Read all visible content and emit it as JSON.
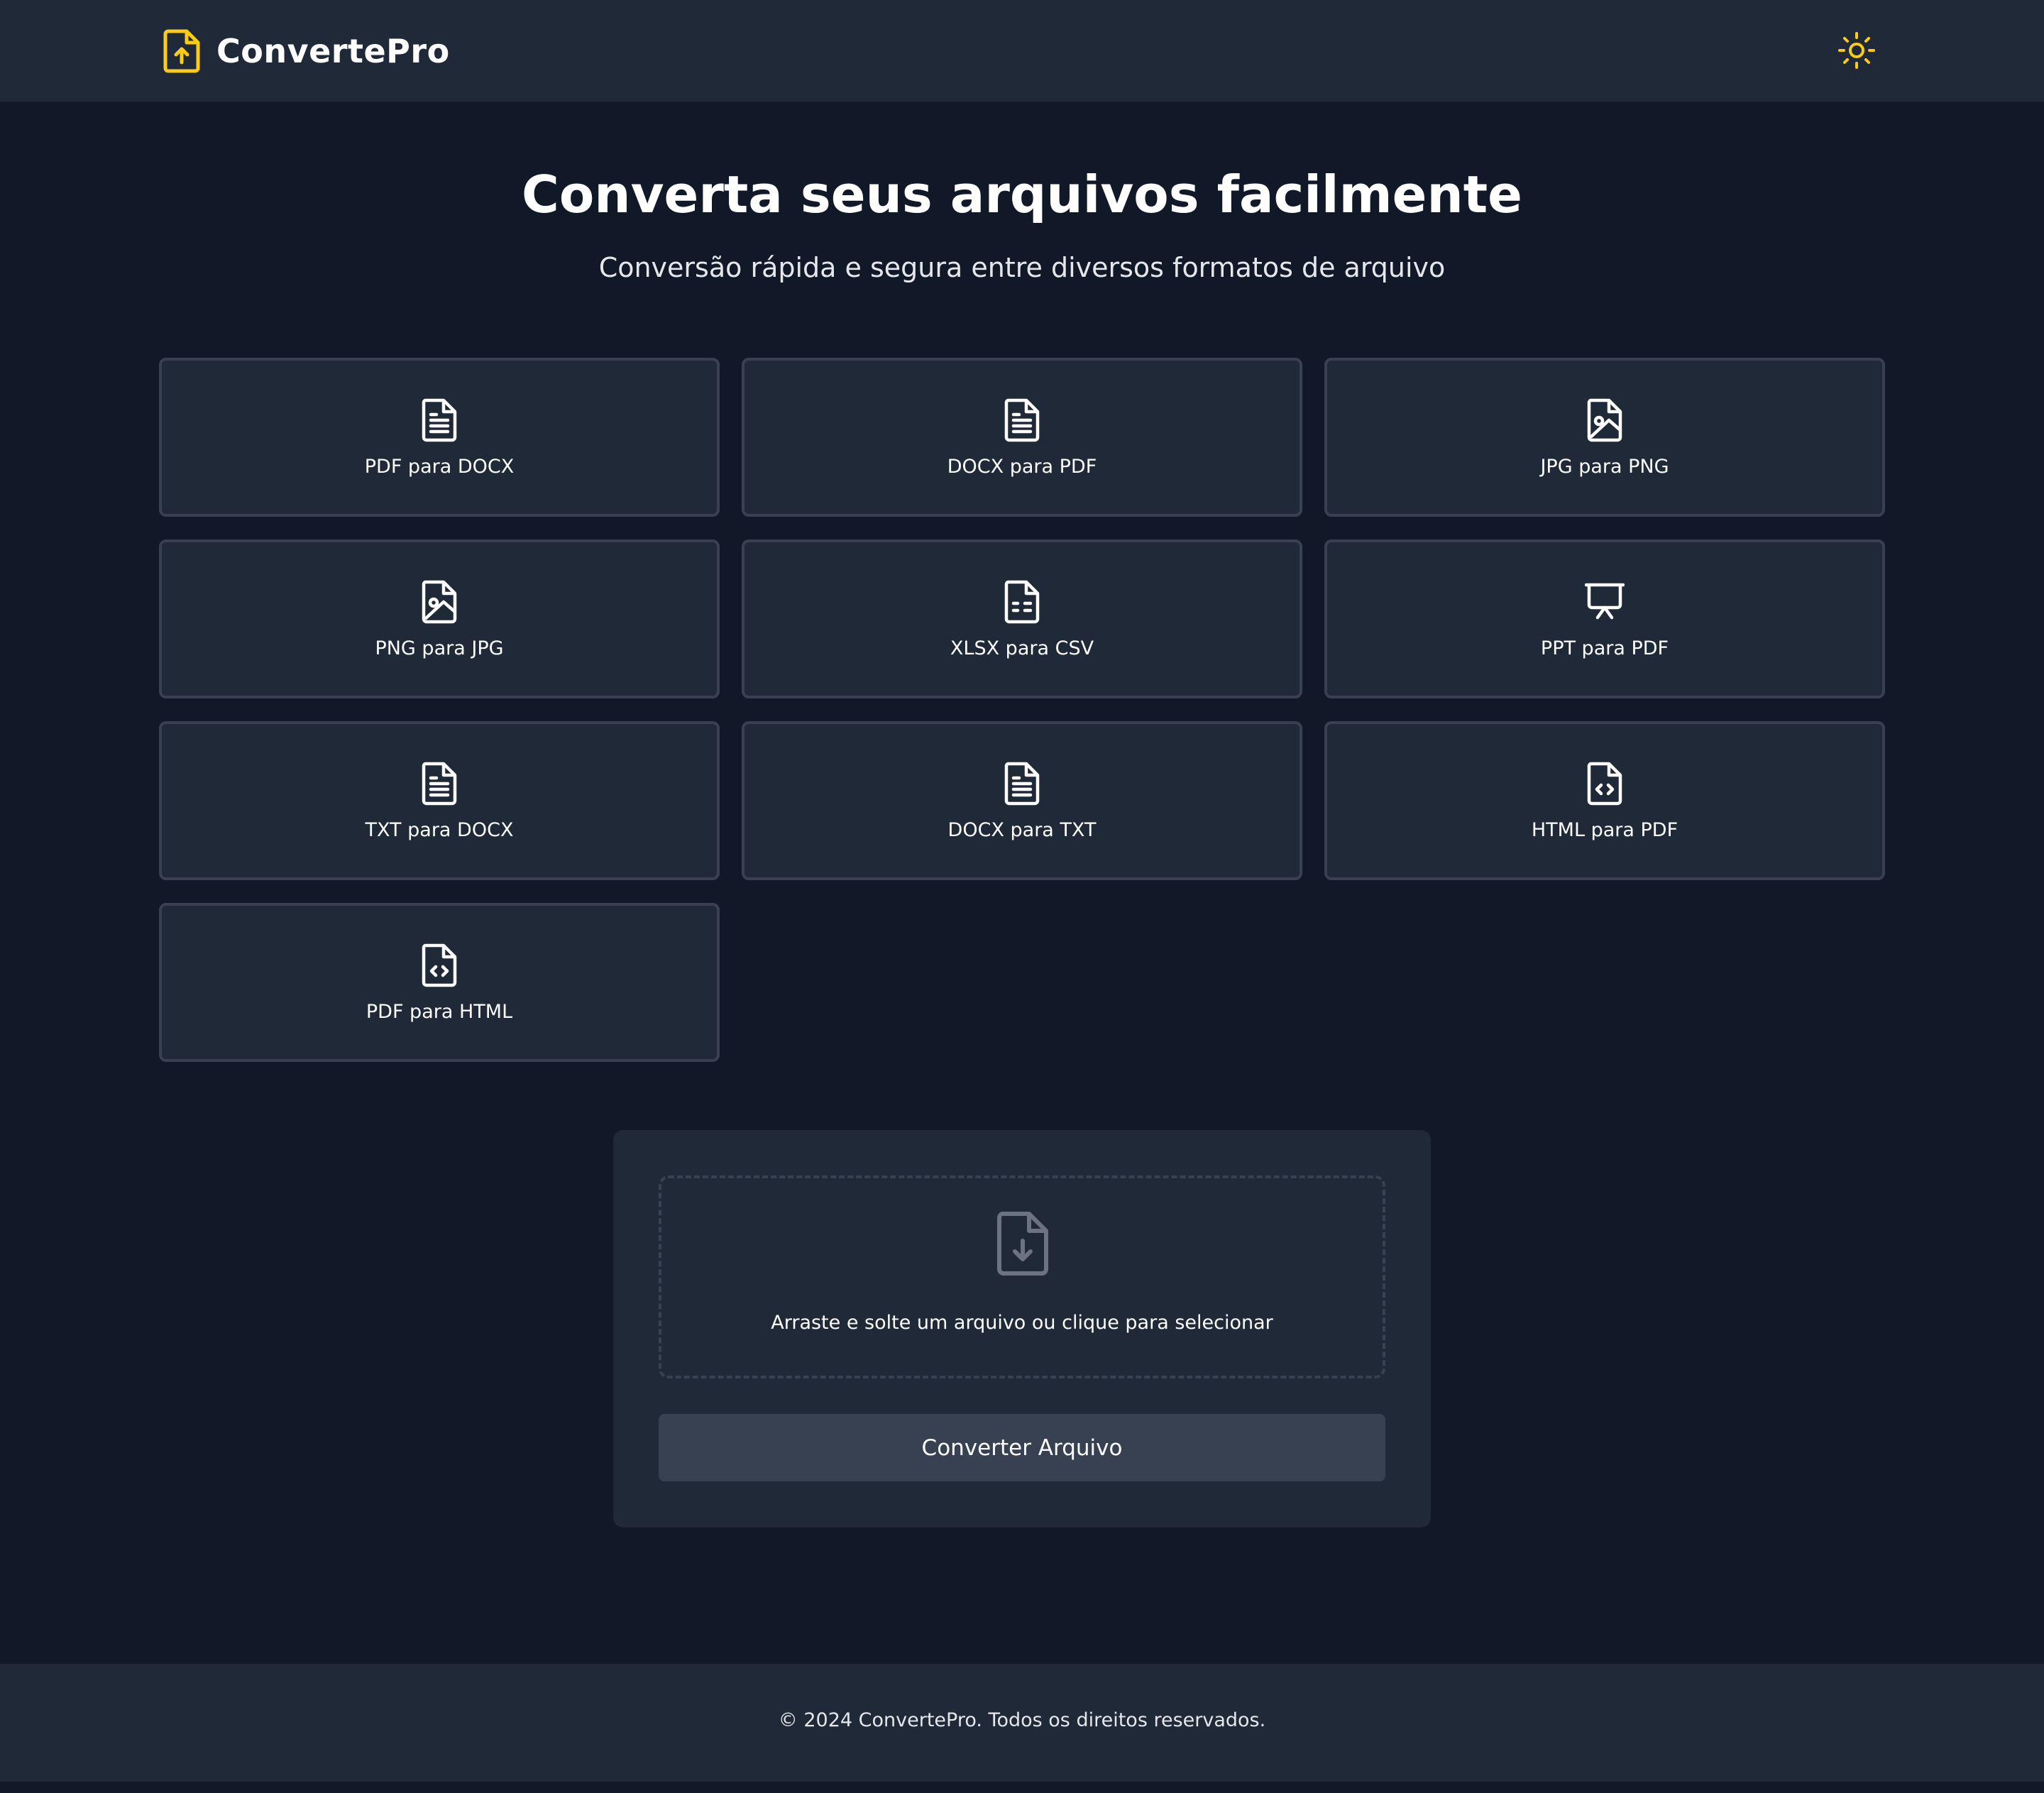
{
  "header": {
    "brand": "ConvertePro",
    "brand_icon": "file-upload-icon",
    "theme_toggle_icon": "sun-icon"
  },
  "colors": {
    "background": "#111827",
    "surface": "#1f2937",
    "border": "#374151",
    "accent": "#facc15",
    "button": "#374151",
    "muted_icon": "#6b7280"
  },
  "hero": {
    "title": "Converta seus arquivos facilmente",
    "subtitle": "Conversão rápida e segura entre diversos formatos de arquivo"
  },
  "converters": [
    {
      "label": "PDF para DOCX",
      "icon": "file-text-icon"
    },
    {
      "label": "DOCX para PDF",
      "icon": "file-text-icon"
    },
    {
      "label": "JPG para PNG",
      "icon": "file-image-icon"
    },
    {
      "label": "PNG para JPG",
      "icon": "file-image-icon"
    },
    {
      "label": "XLSX para CSV",
      "icon": "file-spreadsheet-icon"
    },
    {
      "label": "PPT para PDF",
      "icon": "presentation-icon"
    },
    {
      "label": "TXT para DOCX",
      "icon": "file-text-icon"
    },
    {
      "label": "DOCX para TXT",
      "icon": "file-text-icon"
    },
    {
      "label": "HTML para PDF",
      "icon": "file-code-icon"
    },
    {
      "label": "PDF para HTML",
      "icon": "file-code-icon"
    }
  ],
  "upload": {
    "drop_icon": "file-download-icon",
    "drop_text": "Arraste e solte um arquivo ou clique para selecionar",
    "button_label": "Converter Arquivo"
  },
  "footer": {
    "text": "© 2024 ConvertePro. Todos os direitos reservados."
  }
}
